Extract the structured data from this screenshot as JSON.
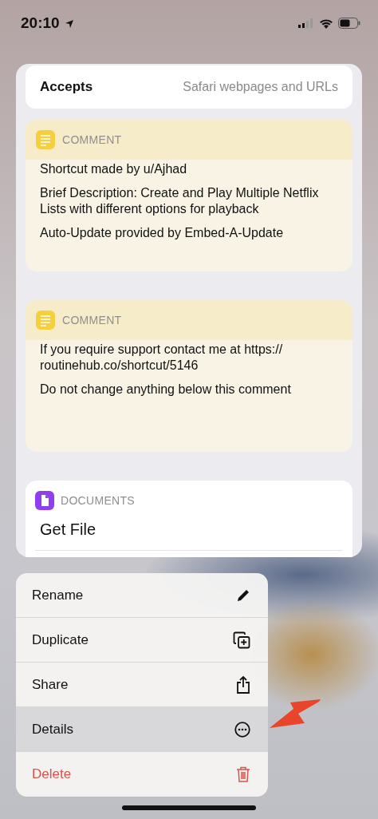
{
  "status_bar": {
    "time": "20:10"
  },
  "accepts": {
    "label": "Accepts",
    "value": "Safari webpages and URLs"
  },
  "comments": [
    {
      "category": "COMMENT",
      "paragraphs": [
        "Shortcut made by u/Ajhad",
        "Brief Description: Create and Play Multiple Netflix Lists with different options for playback",
        "Auto-Update provided by Embed-A-Update"
      ]
    },
    {
      "category": "COMMENT",
      "paragraphs": [
        "If you require support contact me at https://\nroutinehub.co/shortcut/5146",
        "Do not change anything below this comment"
      ]
    }
  ],
  "action": {
    "category": "DOCUMENTS",
    "title": "Get File"
  },
  "menu": [
    {
      "label": "Rename",
      "kind": "normal",
      "selected": false
    },
    {
      "label": "Duplicate",
      "kind": "normal",
      "selected": false
    },
    {
      "label": "Share",
      "kind": "normal",
      "selected": false
    },
    {
      "label": "Details",
      "kind": "normal",
      "selected": true
    },
    {
      "label": "Delete",
      "kind": "destructive",
      "selected": false
    }
  ]
}
